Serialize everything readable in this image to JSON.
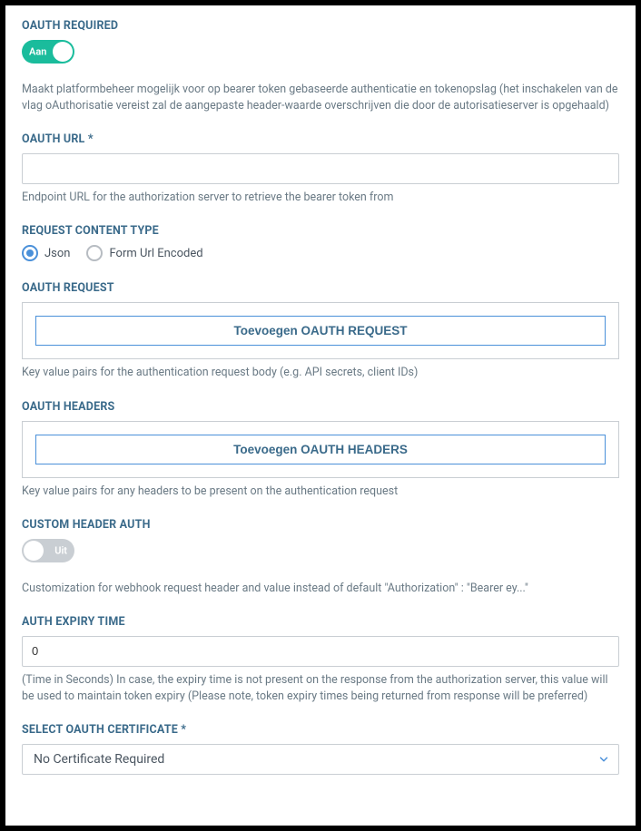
{
  "oauth_required": {
    "label": "OAUTH REQUIRED",
    "toggle_state": "Aan",
    "help": "Maakt platformbeheer mogelijk voor op bearer token gebaseerde authenticatie en tokenopslag (het inschakelen van de vlag oAuthorisatie vereist zal de aangepaste header-waarde overschrijven die door de autorisatieserver is opgehaald)"
  },
  "oauth_url": {
    "label": "OAUTH URL *",
    "value": "",
    "help": "Endpoint URL for the authorization server to retrieve the bearer token from"
  },
  "request_content_type": {
    "label": "REQUEST CONTENT TYPE",
    "options": {
      "json": "Json",
      "form": "Form Url Encoded"
    },
    "selected": "json"
  },
  "oauth_request": {
    "label": "OAUTH REQUEST",
    "button": "Toevoegen OAUTH REQUEST",
    "help": "Key value pairs for the authentication request body (e.g. API secrets, client IDs)"
  },
  "oauth_headers": {
    "label": "OAUTH HEADERS",
    "button": "Toevoegen OAUTH HEADERS",
    "help": "Key value pairs for any headers to be present on the authentication request"
  },
  "custom_header_auth": {
    "label": "CUSTOM HEADER AUTH",
    "toggle_state": "Uit",
    "help": "Customization for webhook request header and value instead of default \"Authorization\" : \"Bearer ey...\""
  },
  "auth_expiry_time": {
    "label": "AUTH EXPIRY TIME",
    "value": "0",
    "help": "(Time in Seconds) In case, the expiry time is not present on the response from the authorization server, this value will be used to maintain token expiry (Please note, token expiry times being returned from response will be preferred)"
  },
  "select_oauth_certificate": {
    "label": "SELECT OAUTH CERTIFICATE *",
    "selected": "No Certificate Required"
  }
}
